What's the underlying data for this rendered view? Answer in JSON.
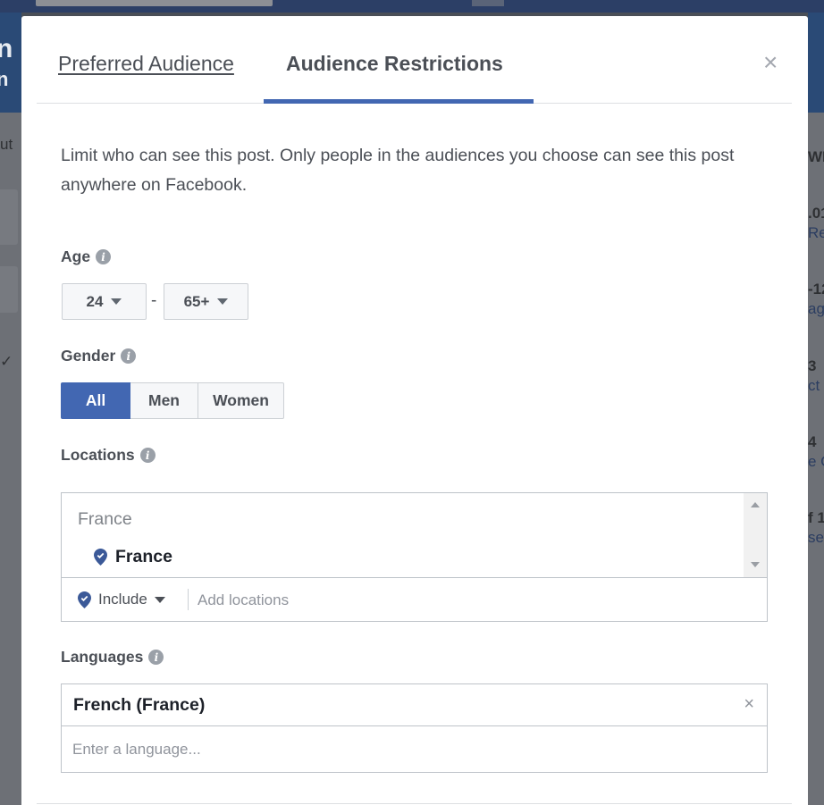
{
  "tabs": {
    "preferred_label": "Preferred Audience",
    "restrictions_label": "Audience Restrictions"
  },
  "close_symbol": "×",
  "description": "Limit who can see this post. Only people in the audiences you choose can see this post anywhere on Facebook.",
  "age": {
    "label": "Age",
    "min": "24",
    "separator": "-",
    "max": "65+"
  },
  "gender": {
    "label": "Gender",
    "options": [
      "All",
      "Men",
      "Women"
    ],
    "selected": "All"
  },
  "locations": {
    "label": "Locations",
    "query": "France",
    "results": [
      "France"
    ],
    "mode": "Include",
    "placeholder": "Add locations"
  },
  "languages": {
    "label": "Languages",
    "selected": [
      "French (France)"
    ],
    "remove_symbol": "×",
    "placeholder": "Enter a language..."
  },
  "info_icon_glyph": "i",
  "background_fragments": {
    "left": [
      "n",
      "n",
      "ut",
      "✓"
    ],
    "right": [
      "WE",
      ".01",
      "Rea",
      "-12",
      "ag",
      "3",
      "ct",
      "4",
      "e C",
      "f 1",
      "se"
    ]
  },
  "colors": {
    "accent": "#4267b2",
    "text": "#4b4f56",
    "overlay": "#4a4f57"
  }
}
